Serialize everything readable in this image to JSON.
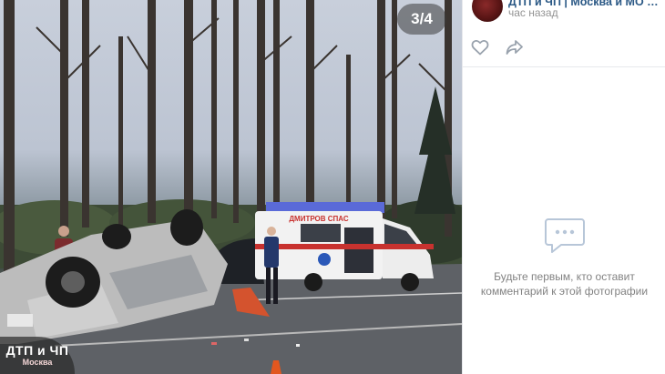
{
  "photo": {
    "counter": "3/4",
    "watermark": {
      "line1": "ДТП и ЧП",
      "line2": "Москва"
    },
    "ambulance_text": "ДМИТРОВ СПАС"
  },
  "author": {
    "name": "ДТП и ЧП | Москва и МО онлайн | ...",
    "time": "час назад"
  },
  "actions": {
    "like_icon": "heart-icon",
    "share_icon": "share-arrow-icon"
  },
  "comments": {
    "empty_icon": "speech-bubble-icon",
    "empty_text": "Будьте первым, кто оставит комментарий к этой фотографии"
  },
  "colors": {
    "link": "#2a5885",
    "muted": "#939393",
    "icon": "#99a2ad"
  }
}
